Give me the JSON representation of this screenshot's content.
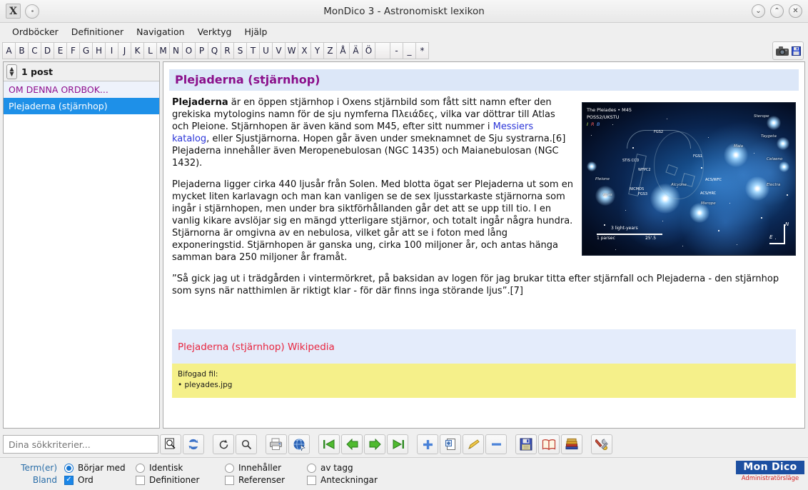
{
  "window": {
    "title": "MonDico 3 - Astronomiskt lexikon",
    "app_icon": "X",
    "minimize": "⌄",
    "maximize": "⌃",
    "close": "✕"
  },
  "menubar": {
    "items": [
      {
        "label": "Ordböcker"
      },
      {
        "label": "Definitioner"
      },
      {
        "label": "Navigation"
      },
      {
        "label": "Verktyg"
      },
      {
        "label": "Hjälp"
      }
    ]
  },
  "alphabar": {
    "letters": [
      "A",
      "B",
      "C",
      "D",
      "E",
      "F",
      "G",
      "H",
      "I",
      "J",
      "K",
      "L",
      "M",
      "N",
      "O",
      "P",
      "Q",
      "R",
      "S",
      "T",
      "U",
      "V",
      "W",
      "X",
      "Y",
      "Z",
      "Å",
      "Ä",
      "Ö"
    ],
    "symbols": [
      "-",
      "_",
      "*"
    ],
    "screenshot_button": "camera-save"
  },
  "sidebar": {
    "count_label": "1 post",
    "items": [
      {
        "label": "OM DENNA ORDBOK...",
        "state": "about"
      },
      {
        "label": "Plejaderna (stjärnhop)",
        "state": "selected"
      }
    ]
  },
  "article": {
    "title": "Plejaderna (stjärnhop)",
    "paragraph1": {
      "lead": "Plejaderna",
      "text_a": " är en öppen stjärnhop i Oxens stjärnbild som fått sitt namn efter den grekiska mytologins namn för de sju nymferna Πλειάδες, vilka var döttrar till Atlas och Pleione. Stjärnhopen är även känd som M45, efter sitt nummer i ",
      "link": "Messiers katalog",
      "text_b": ", eller Sjustjärnorna. Hopen går även under smeknamnet de Sju systrarna.[6] Plejaderna innehåller även Meropenebulosan (NGC 1435) och Maianebulosan (NGC 1432)."
    },
    "paragraph2": "Plejaderna ligger cirka 440 ljusår från Solen. Med blotta ögat ser Plejaderna ut som en mycket liten karlavagn och man kan vanligen se de sex ljusstarkaste stjärnorna som ingår i stjärnhopen, men under bra siktförhållanden går det att se upp till tio. I en vanlig kikare avslöjar sig en mängd ytterligare stjärnor, och totalt ingår några hundra. Stjärnorna är omgivna av en nebulosa, vilket går att se i foton med lång exponeringstid. Stjärnhopen är ganska ung, cirka 100 miljoner år, och antas hänga samman bara 250 miljoner år framåt.",
    "paragraph3": "”Så gick jag ut i trädgården i vintermörkret, på baksidan av logen för jag brukar titta efter stjärnfall och Plejaderna - den stjärnhop som syns när natthimlen är riktigt klar - för där finns inga störande ljus”.[7]",
    "wikipedia_link": "Plejaderna (stjärnhop) Wikipedia",
    "attachment_title": "Bifogad fil:",
    "attachment_file": "• pleyades.jpg"
  },
  "image": {
    "credit_line1": "The Pleiades • M45",
    "credit_line2": "POSS2/UKSTU",
    "credit_line3_i": "I",
    "credit_line3_r": "R",
    "credit_line3_b": "B",
    "scale_top": "3 light-years",
    "scale_left": "1 parsec",
    "scale_right": "25'.5",
    "compass_n": "N",
    "compass_e": "E",
    "instruments": [
      "FGS2",
      "FGS1",
      "FGS3",
      "STIS CCD",
      "WFPC2",
      "NICMOS",
      "ACS/WFC",
      "ACS/HRC"
    ],
    "stars": [
      "Sterope",
      "Taygeta",
      "Maia",
      "Celaeno",
      "Electra",
      "Alcyone",
      "Merope",
      "Pleione",
      "Atlas"
    ]
  },
  "bottom_toolbar": {
    "search_placeholder": "Dina sökkriterier...",
    "buttons": [
      {
        "name": "search-exec",
        "icon": "magnifier-page"
      },
      {
        "name": "refresh-search",
        "icon": "refresh-blue"
      },
      {
        "name": "reload",
        "icon": "reload"
      },
      {
        "name": "find",
        "icon": "magnifier"
      },
      {
        "name": "print",
        "icon": "printer"
      },
      {
        "name": "web",
        "icon": "globe"
      },
      {
        "name": "first",
        "icon": "first-arrow"
      },
      {
        "name": "previous",
        "icon": "left-arrow"
      },
      {
        "name": "next",
        "icon": "right-arrow"
      },
      {
        "name": "last",
        "icon": "last-arrow"
      },
      {
        "name": "add",
        "icon": "plus"
      },
      {
        "name": "duplicate",
        "icon": "copy-page"
      },
      {
        "name": "edit",
        "icon": "pencil"
      },
      {
        "name": "delete",
        "icon": "minus"
      },
      {
        "name": "save",
        "icon": "floppy"
      },
      {
        "name": "open-book",
        "icon": "book"
      },
      {
        "name": "dictionaries",
        "icon": "books"
      },
      {
        "name": "tools",
        "icon": "tools"
      }
    ]
  },
  "filters": {
    "row1_label": "Term(er)",
    "row2_label": "Bland",
    "modes": [
      {
        "label": "Börjar med",
        "checked": true
      },
      {
        "label": "Identisk",
        "checked": false
      },
      {
        "label": "Innehåller",
        "checked": false
      },
      {
        "label": "av tagg",
        "checked": false
      }
    ],
    "scopes": [
      {
        "label": "Ord",
        "checked": true
      },
      {
        "label": "Definitioner",
        "checked": false
      },
      {
        "label": "Referenser",
        "checked": false
      },
      {
        "label": "Anteckningar",
        "checked": false
      }
    ]
  },
  "logo": {
    "brand": "Mon Dico",
    "mode": "Administratörsläge"
  }
}
